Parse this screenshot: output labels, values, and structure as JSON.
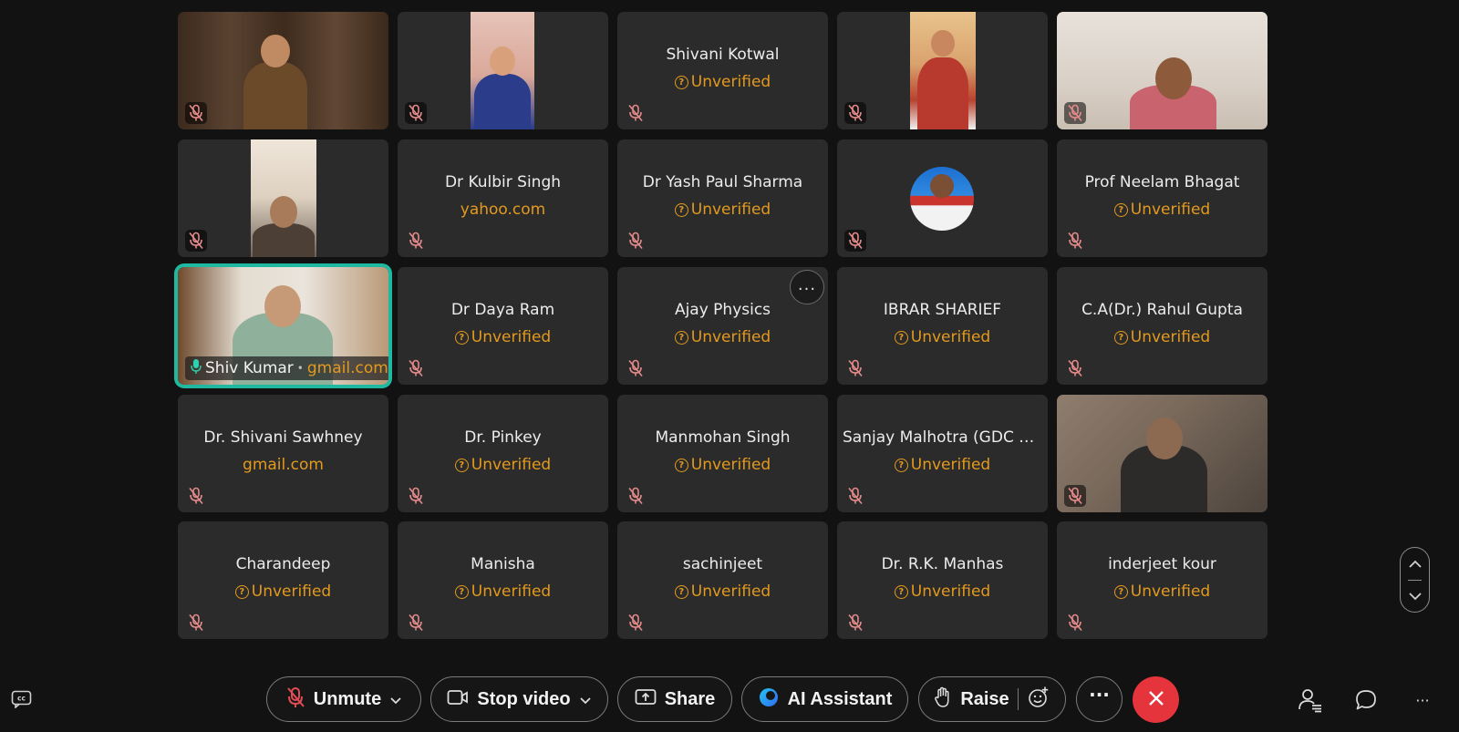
{
  "tiles": [
    {
      "name": "",
      "status": "",
      "video": "v1"
    },
    {
      "name": "",
      "status": "",
      "video": "v2"
    },
    {
      "name": "Shivani Kotwal",
      "status": "Unverified"
    },
    {
      "name": "",
      "status": "",
      "video": "v4"
    },
    {
      "name": "",
      "status": "",
      "video": "v5"
    },
    {
      "name": "",
      "status": "",
      "video": "v6"
    },
    {
      "name": "Dr Kulbir Singh",
      "status": "yahoo.com"
    },
    {
      "name": "Dr Yash Paul Sharma",
      "status": "Unverified"
    },
    {
      "name": "",
      "status": "",
      "video": "avatar"
    },
    {
      "name": "Prof Neelam Bhagat",
      "status": "Unverified"
    },
    {
      "name": "Shiv Kumar",
      "status": "gmail.com",
      "video": "v11",
      "active": true
    },
    {
      "name": "Dr Daya Ram",
      "status": "Unverified"
    },
    {
      "name": "Ajay Physics",
      "status": "Unverified",
      "more": true
    },
    {
      "name": "IBRAR SHARIEF",
      "status": "Unverified"
    },
    {
      "name": "C.A(Dr.) Rahul Gupta",
      "status": "Unverified"
    },
    {
      "name": "Dr. Shivani Sawhney",
      "status": "gmail.com"
    },
    {
      "name": "Dr. Pinkey",
      "status": "Unverified"
    },
    {
      "name": "Manmohan Singh",
      "status": "Unverified"
    },
    {
      "name": "Sanjay Malhotra (GDC R...",
      "status": "Unverified"
    },
    {
      "name": "",
      "status": "",
      "video": "v20"
    },
    {
      "name": "Charandeep",
      "status": "Unverified"
    },
    {
      "name": "Manisha",
      "status": "Unverified"
    },
    {
      "name": "sachinjeet",
      "status": "Unverified"
    },
    {
      "name": "Dr. R.K. Manhas",
      "status": "Unverified"
    },
    {
      "name": "inderjeet kour",
      "status": "Unverified"
    }
  ],
  "toolbar": {
    "unmute": "Unmute",
    "stop_video": "Stop video",
    "share": "Share",
    "ai_assistant": "AI Assistant",
    "raise": "Raise",
    "more": "···"
  },
  "colors": {
    "accent_verified": "#e39a1e",
    "active_speaker_border": "#1fb9a2",
    "end_call": "#e5343b",
    "muted_icon": "#e58a8a"
  }
}
